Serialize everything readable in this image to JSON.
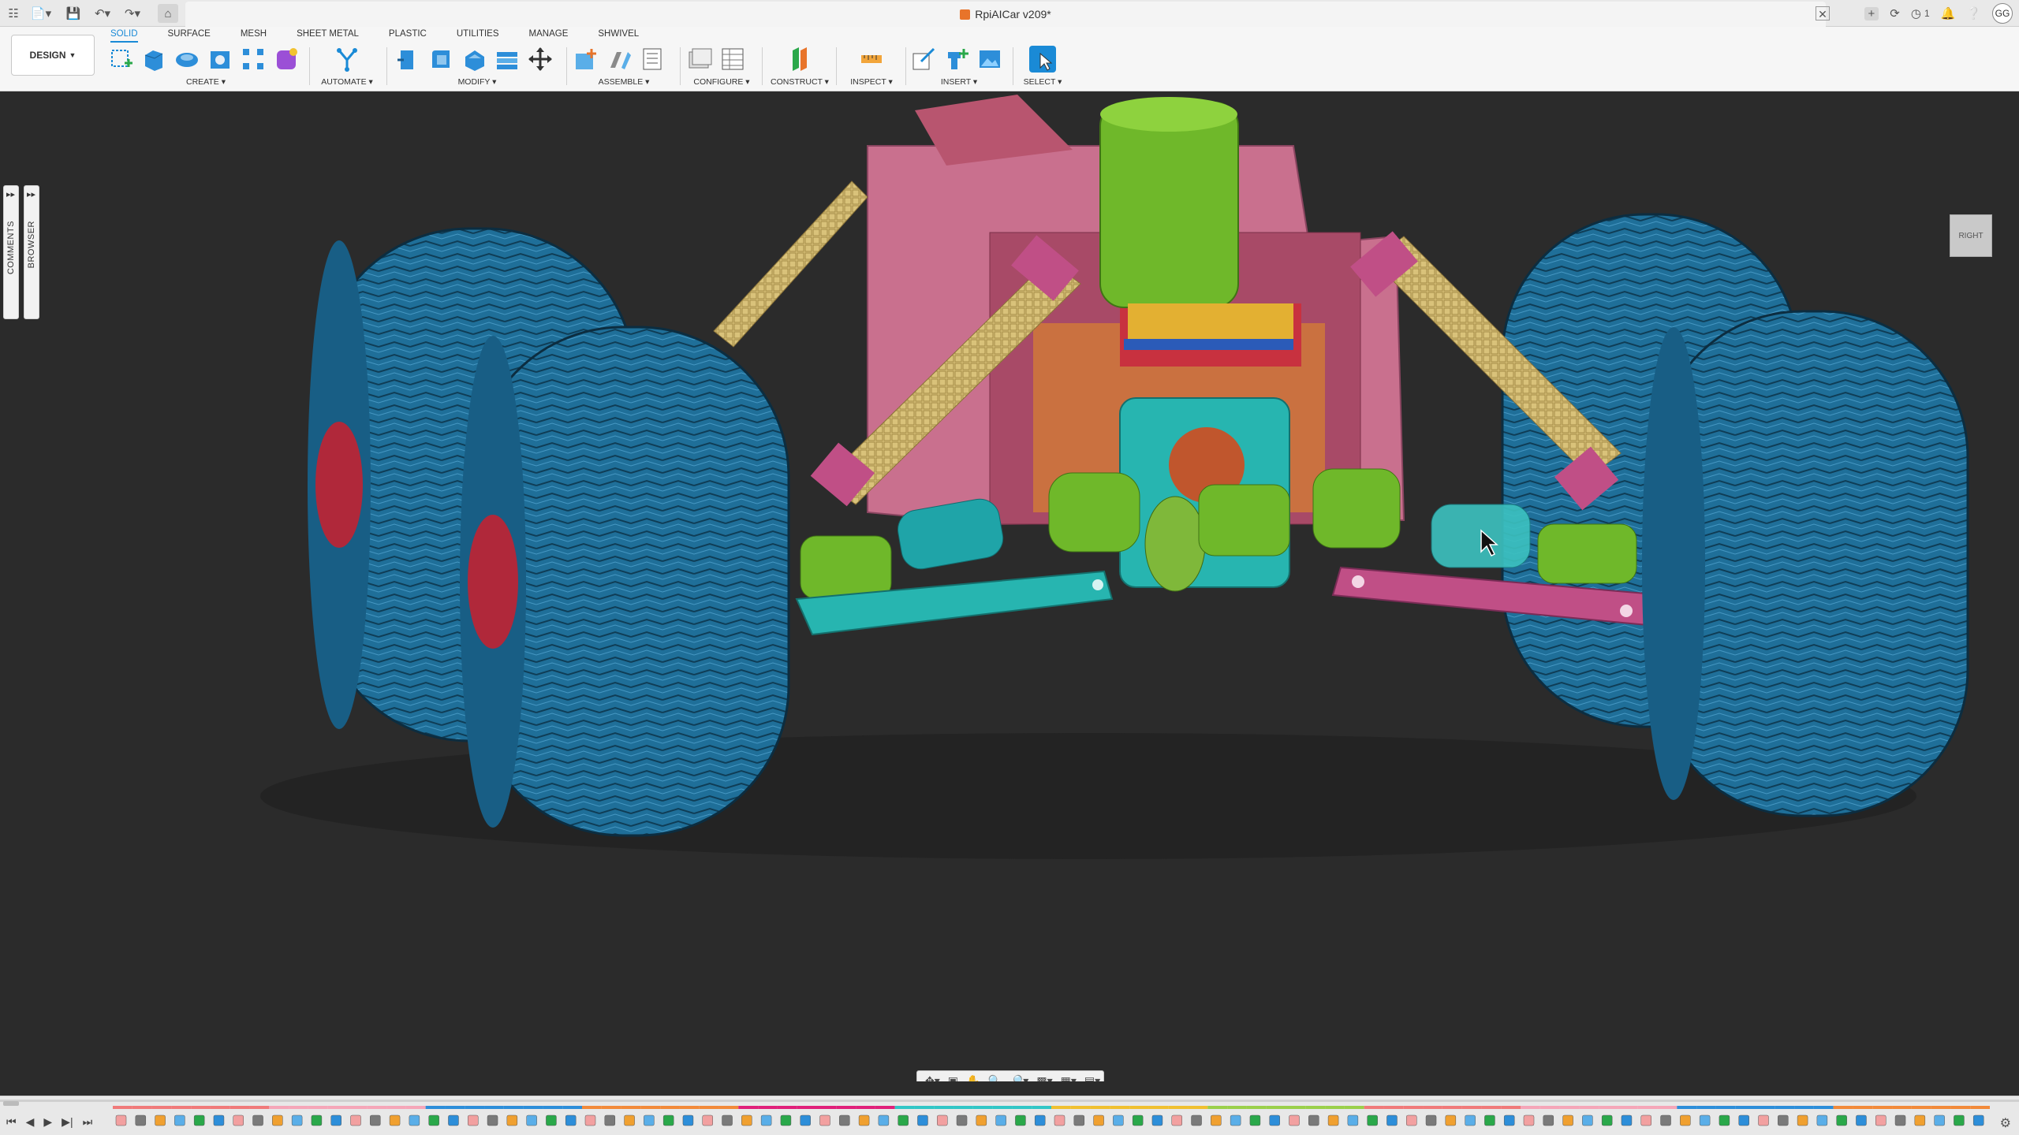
{
  "titlebar": {
    "document_title": "RpiAICar v209*",
    "avatar_initials": "GG",
    "notification_count": "1"
  },
  "ribbon": {
    "workspace": "DESIGN",
    "tabs": [
      "SOLID",
      "SURFACE",
      "MESH",
      "SHEET METAL",
      "PLASTIC",
      "UTILITIES",
      "MANAGE",
      "SHWIVEL"
    ],
    "active_tab": "SOLID",
    "groups": [
      "CREATE",
      "AUTOMATE",
      "MODIFY",
      "ASSEMBLE",
      "CONFIGURE",
      "CONSTRUCT",
      "INSPECT",
      "INSERT",
      "SELECT"
    ]
  },
  "side_panels": {
    "comments": "COMMENTS",
    "browser": "BROWSER"
  },
  "viewcube": {
    "face": "RIGHT"
  },
  "colors": {
    "accent": "#1a8ad6",
    "tire": "#1f6f99",
    "chassis": "#c9708e",
    "axle": "#6fb82a",
    "arm_cyan": "#27b5b0",
    "arm_pink": "#c04f86",
    "hub": "#c8313f",
    "viewport_bg": "#2b2b2b"
  },
  "timeline": {
    "feature_icons": [
      "sketch",
      "extrude",
      "joint",
      "component",
      "construct",
      "pattern"
    ],
    "feature_count": 96
  }
}
